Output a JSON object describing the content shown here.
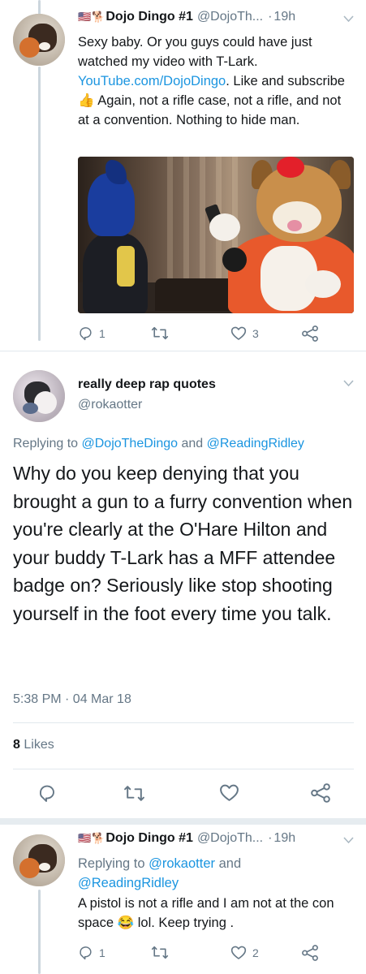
{
  "tweet1": {
    "display_name": "Dojo Dingo #1",
    "flag_emoji": "🇺🇸",
    "name_emoji": "🐕",
    "handle": "@DojoTh...",
    "time": "19h",
    "text_part1": "Sexy baby. Or you guys could have just watched my video with T-Lark. ",
    "link": "YouTube.com/DojoDingo",
    "text_part2": ". Like and subscribe ",
    "thumbs_emoji": "👍",
    "text_part3": " Again, not a rifle case, not a rifle, and not at a convention. Nothing to hide man.",
    "reply_count": "1",
    "retweet_count": "",
    "like_count": "3"
  },
  "main_tweet": {
    "display_name": "really deep rap quotes",
    "handle": "@rokaotter",
    "replying_prefix": "Replying to ",
    "reply_to_1": "@DojoTheDingo",
    "reply_and": " and ",
    "reply_to_2": "@ReadingRidley",
    "text": "Why do you keep denying that you brought a gun to a furry convention when you're clearly at the O'Hare Hilton and your buddy T-Lark has a MFF attendee badge on? Seriously like stop shooting yourself in the foot every time you talk.",
    "timestamp": "5:38 PM · 04 Mar 18",
    "likes_count": "8",
    "likes_label": "Likes"
  },
  "tweet3": {
    "display_name": "Dojo Dingo #1",
    "flag_emoji": "🇺🇸",
    "name_emoji": "🐕",
    "handle": "@DojoTh...",
    "time": "19h",
    "replying_prefix": "Replying to ",
    "reply_to_1": "@rokaotter",
    "reply_and": " and",
    "reply_to_2": "@ReadingRidley",
    "text_part1": "A pistol is not a rifle and I am not at the con space ",
    "laugh_emoji": "😂",
    "text_part2": " lol. Keep trying .",
    "reply_count": "1",
    "retweet_count": "",
    "like_count": "2"
  },
  "colors": {
    "link": "#1b95e0",
    "secondary_text": "#657786",
    "icon": "#657786",
    "thread_line": "#ccd6dd",
    "divider": "#e1e8ed"
  },
  "icons": [
    "reply-icon",
    "retweet-icon",
    "like-icon",
    "share-icon",
    "chevron-down-icon"
  ]
}
